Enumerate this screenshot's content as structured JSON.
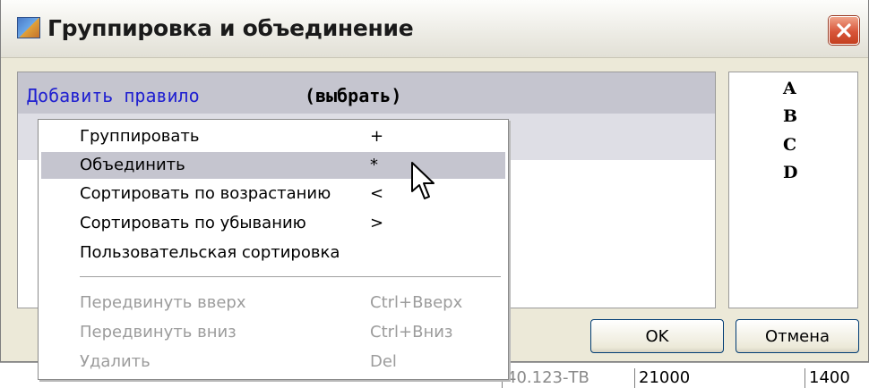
{
  "window": {
    "title": "Группировка и объединение",
    "close_symbol": "✕"
  },
  "rules": {
    "add_rule": "Добавить правило",
    "choose": "(выбрать)"
  },
  "columns": [
    "A",
    "B",
    "C",
    "D"
  ],
  "buttons": {
    "ok": "OK",
    "cancel": "Отмена"
  },
  "menu": {
    "items": [
      {
        "label": "Группировать",
        "shortcut": "+"
      },
      {
        "label": "Объединить",
        "shortcut": "*"
      },
      {
        "label": "Сортировать по возрастанию",
        "shortcut": "<"
      },
      {
        "label": "Сортировать по убыванию",
        "shortcut": ">"
      },
      {
        "label": "Пользовательская сортировка",
        "shortcut": ""
      },
      {
        "label": "Передвинуть вверх",
        "shortcut": "Ctrl+Вверх"
      },
      {
        "label": "Передвинуть вниз",
        "shortcut": "Ctrl+Вниз"
      },
      {
        "label": "Удалить",
        "shortcut": "Del"
      }
    ]
  },
  "sheet": {
    "cells": [
      "40.123-ТВ",
      "21000",
      "1400"
    ]
  },
  "colors": {
    "highlight": "#c5c5cf",
    "link_blue": "#2020d0",
    "disabled_text": "#9c9c9c"
  }
}
